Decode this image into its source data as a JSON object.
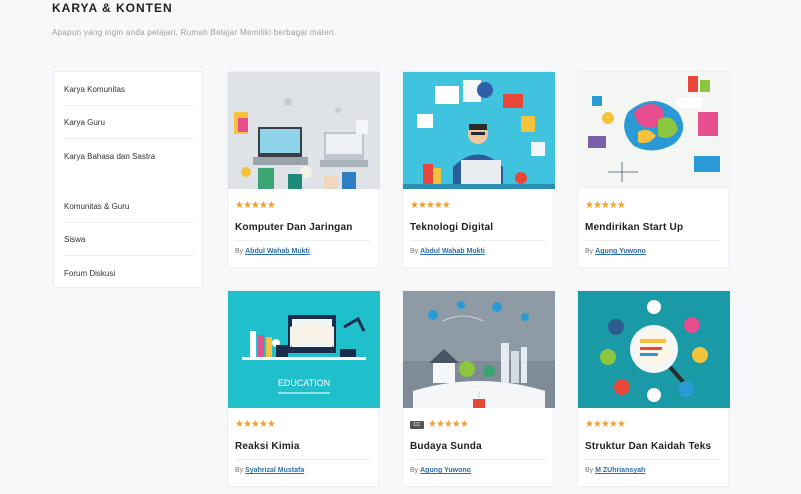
{
  "header": {
    "title": "KARYA & KONTEN",
    "subtitle": "Apapun yang ingin anda pelajari, Rumah Belajar Memiliki berbagai materi."
  },
  "sidebar": {
    "items": [
      {
        "label": "Karya Komunitas"
      },
      {
        "label": "Karya Guru"
      },
      {
        "label": "Karya Bahasa dan Sastra"
      },
      {
        "label": "Komunitas & Guru"
      },
      {
        "label": "Siswa"
      },
      {
        "label": "Forum Diskusi"
      }
    ]
  },
  "cards": [
    {
      "title": "Komputer Dan Jaringan",
      "by": "By",
      "author": "Abdul Wahab Mukti",
      "stars": "★★★★★",
      "badge": ""
    },
    {
      "title": "Teknologi Digital",
      "by": "By",
      "author": "Abdul Wahab Mukti",
      "stars": "★★★★★",
      "badge": ""
    },
    {
      "title": "Mendirikan Start Up",
      "by": "By",
      "author": "Agung Yuwono",
      "stars": "★★★★★",
      "badge": ""
    },
    {
      "title": "Reaksi Kimia",
      "by": "By",
      "author": "Syahrizal Mustafa",
      "stars": "★★★★★",
      "badge": ""
    },
    {
      "title": "Budaya Sunda",
      "by": "By",
      "author": "Agung Yuwono",
      "stars": "★★★★★",
      "badge": "CC"
    },
    {
      "title": "Struktur Dan Kaidah Teks",
      "by": "By",
      "author": "M ZUhriansyah",
      "stars": "★★★★★",
      "badge": ""
    }
  ],
  "thumb_text": {
    "education": "EDUCATION"
  },
  "colors": {
    "accent_link": "#2d6fa8",
    "star": "#f0a030",
    "teal": "#1fc1cc"
  }
}
